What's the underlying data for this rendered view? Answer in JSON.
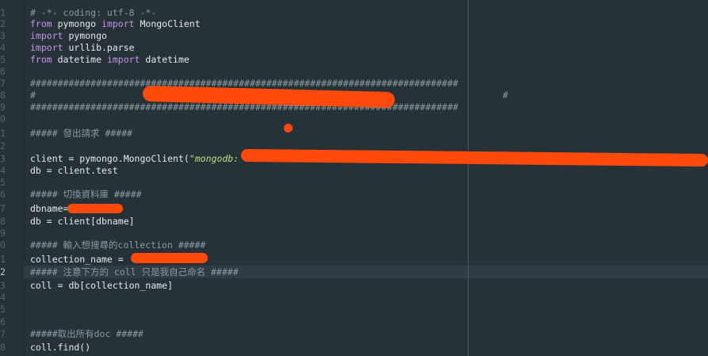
{
  "editor": {
    "line_numbers": [
      "1",
      "2",
      "3",
      "4",
      "5",
      "6",
      "7",
      "8",
      "9",
      "0",
      "1",
      "2",
      "3",
      "4",
      "5",
      "6",
      "7",
      "8",
      "9",
      "0",
      "1",
      "2",
      "3",
      "4",
      "5",
      "6",
      "7",
      "8"
    ],
    "active_line_number": "2",
    "lines": {
      "l1": "# -*- coding: utf-8 -*-",
      "l2_kw1": "from",
      "l2_mod": " pymongo ",
      "l2_kw2": "import",
      "l2_name": " MongoClient",
      "l3_kw": "import",
      "l3_mod": " pymongo",
      "l4_kw": "import",
      "l4_mod": " urllib.parse",
      "l5_kw1": "from",
      "l5_mod": " datetime ",
      "l5_kw2": "import",
      "l5_name": " datetime",
      "l7": "##############################################################################",
      "l8_a": "#",
      "l8_b": "#",
      "l9": "##############################################################################",
      "l11": "##### 發出請求 #####",
      "l13_a": "client = pymongo.MongoClient(",
      "l13_str": "\"mongodb:",
      "l14": "db = client.test",
      "l16": "##### 切換資料庫 #####",
      "l17": "dbname=",
      "l18": "db = client[dbname]",
      "l20": "##### 輸入想搜尋的collection #####",
      "l21": "collection_name = ",
      "l22": "##### 注意下方的 coll 只是我自己命名 #####",
      "l23": "coll = db[collection_name]",
      "l27": "#####取出所有doc #####",
      "l28": "coll.find()"
    }
  }
}
